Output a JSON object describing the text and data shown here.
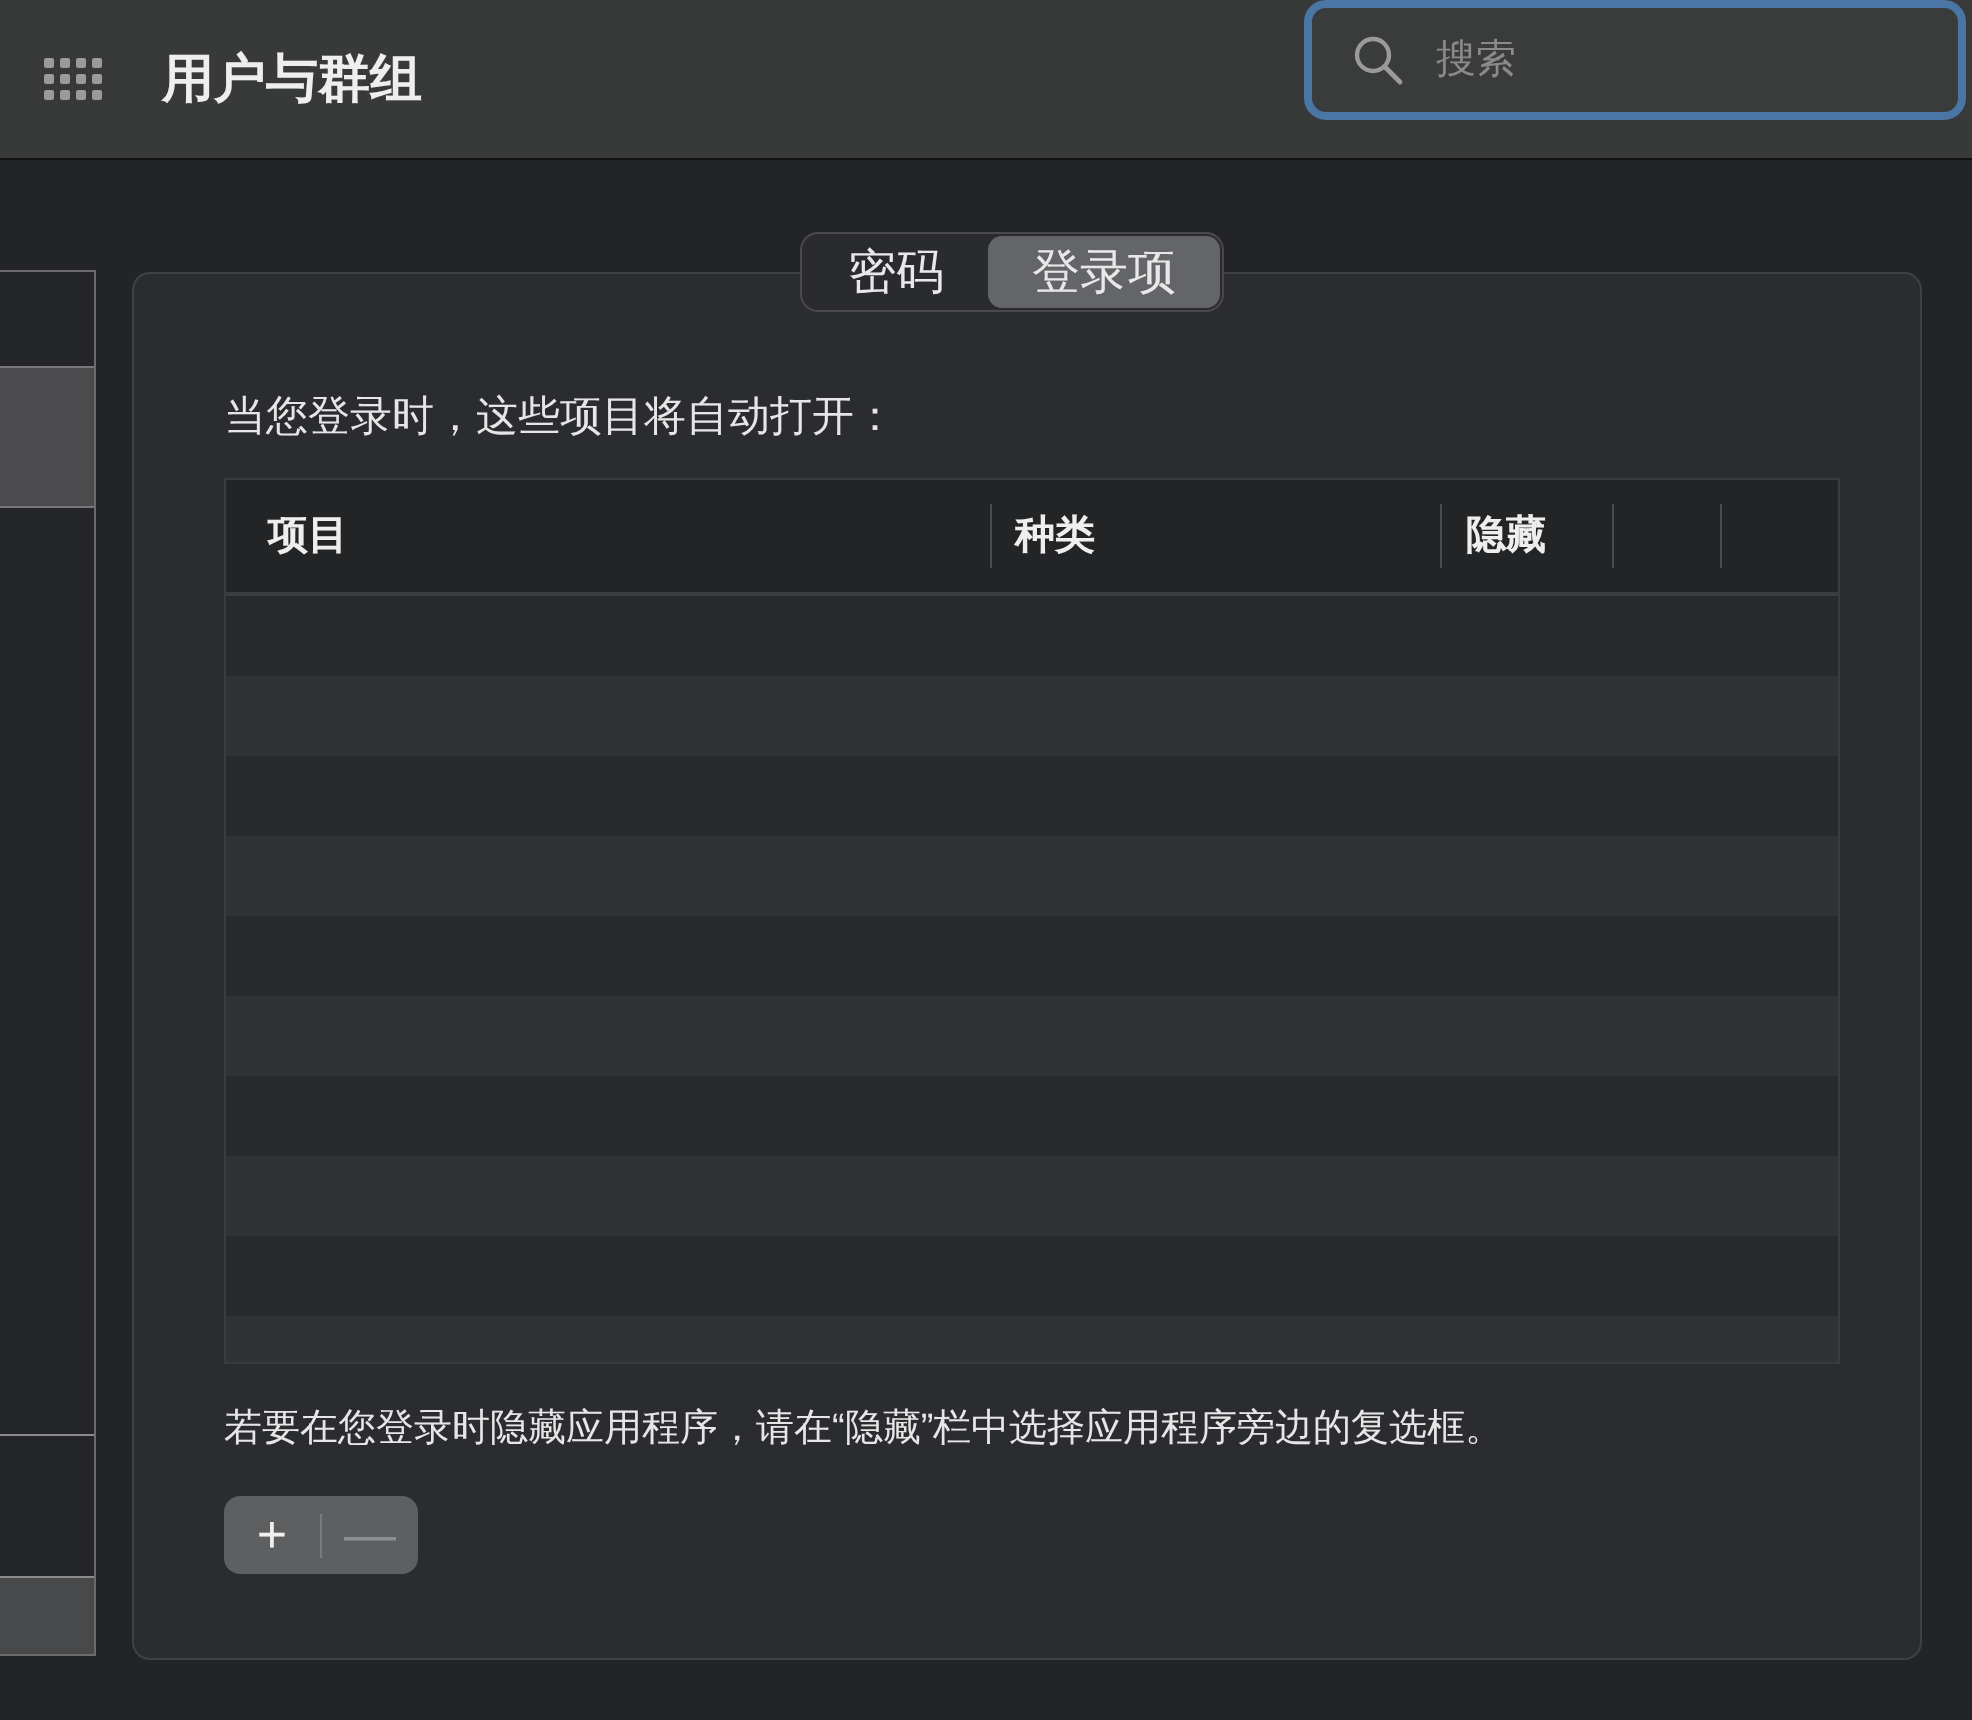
{
  "window": {
    "title": "用户与群组"
  },
  "search": {
    "placeholder": "搜索"
  },
  "tabs": [
    {
      "label": "密码",
      "selected": false
    },
    {
      "label": "登录项",
      "selected": true
    }
  ],
  "login_items": {
    "caption": "当您登录时，这些项目将自动打开：",
    "columns": [
      "项目",
      "种类",
      "隐藏"
    ],
    "hint": "若要在您登录时隐藏应用程序，请在“隐藏”栏中选择应用程序旁边的复选框。",
    "buttons": [
      {
        "label": "+",
        "disabled": false
      },
      {
        "label": "—",
        "disabled": true
      }
    ]
  }
}
